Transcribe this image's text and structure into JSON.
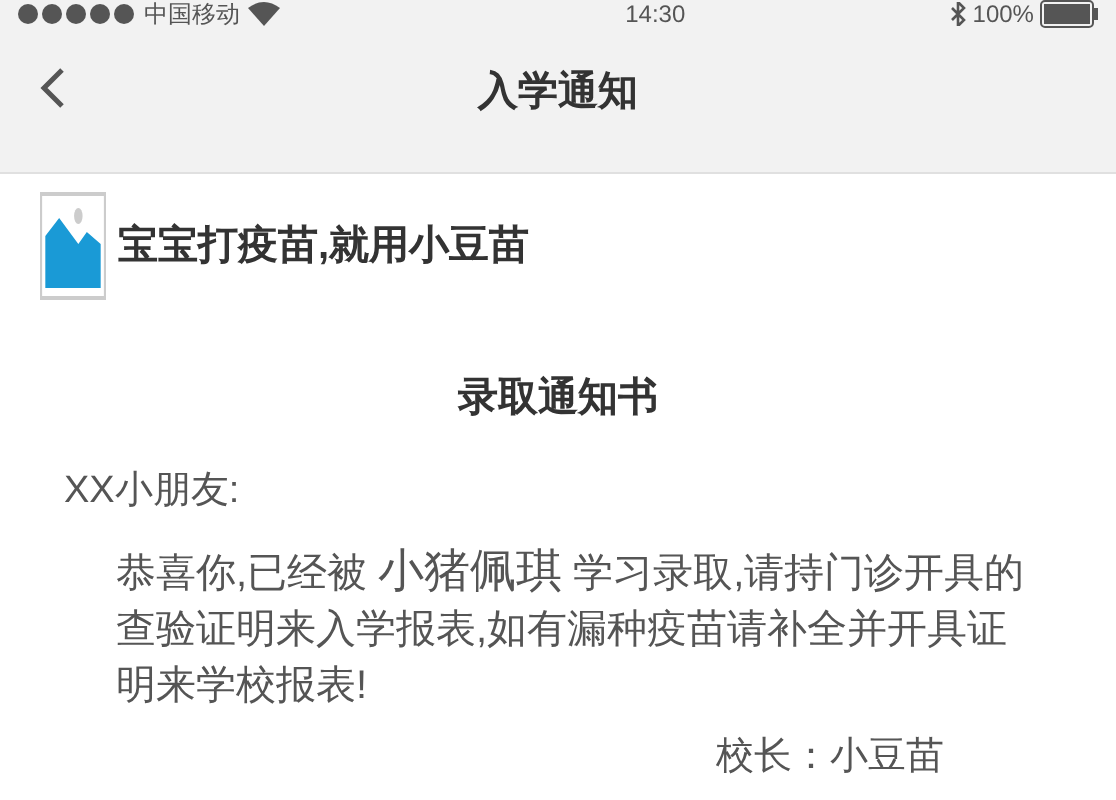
{
  "status_bar": {
    "carrier": "中国移动",
    "time": "14:30",
    "battery": "100%"
  },
  "nav": {
    "title": "入学通知"
  },
  "header": {
    "title": "宝宝打疫苗,就用小豆苗"
  },
  "letter": {
    "title": "录取通知书",
    "greeting": "XX小朋友:",
    "paragraph": [
      {
        "kind": "plain",
        "text": "恭喜你,已经被 "
      },
      {
        "kind": "name",
        "text": "小猪佩琪"
      },
      {
        "kind": "plain",
        "text": " 学习录取,请持门诊开具的查验证明来入学报表,如有漏种疫苗请补全并开具证明来学校报表!"
      }
    ],
    "signature": "校长：小豆苗"
  }
}
